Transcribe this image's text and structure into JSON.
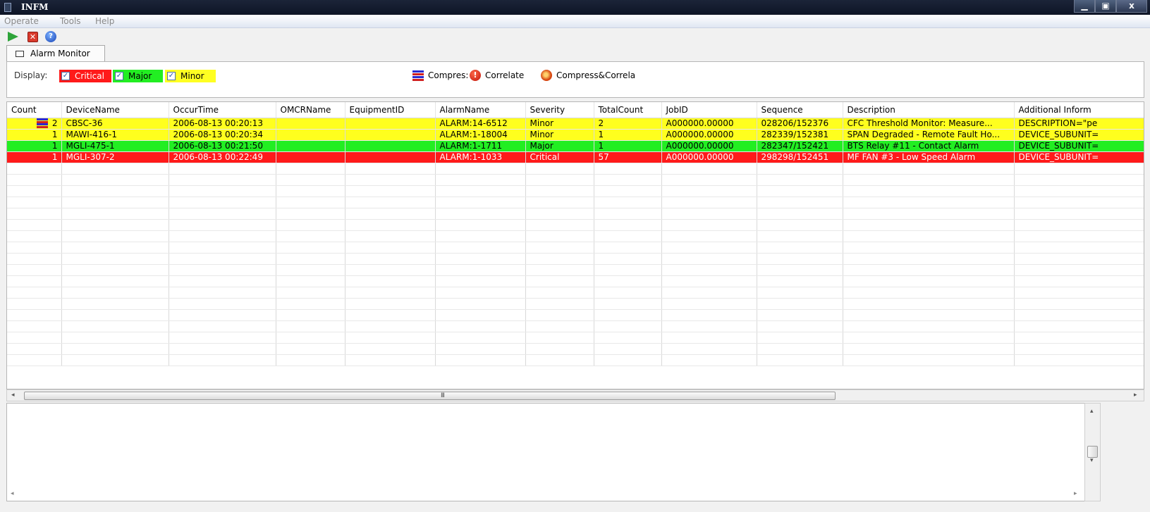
{
  "window": {
    "title": "INFM",
    "buttons": {
      "minimize": "▁",
      "restore": "▣",
      "close": "x"
    }
  },
  "menubar": {
    "items": [
      "Operate",
      "Tools",
      "Help"
    ]
  },
  "toolbar": {
    "stop_glyph": "✕",
    "help_glyph": "?"
  },
  "tabs": [
    {
      "label": "Alarm Monitor"
    }
  ],
  "filters": {
    "display_label": "Display:",
    "critical": {
      "label": "Critical",
      "checked": true,
      "color": "#ff1a1a"
    },
    "major": {
      "label": "Major",
      "checked": true,
      "color": "#22ee22"
    },
    "minor": {
      "label": "Minor",
      "checked": true,
      "color": "#ffff22"
    },
    "check_glyph": "✓"
  },
  "legend": {
    "compress": "Compres:",
    "correlate": "Correlate",
    "correlate_glyph": "!",
    "compress_correlate": "Compress&Correla"
  },
  "table": {
    "columns": [
      "Count",
      "DeviceName",
      "OccurTime",
      "OMCRName",
      "EquipmentID",
      "AlarmName",
      "Severity",
      "TotalCount",
      "JobID",
      "Sequence",
      "Description",
      "Additional Inform"
    ],
    "rows": [
      {
        "severity": "minor",
        "compressed": true,
        "cells": [
          "2",
          "CBSC-36",
          "2006-08-13 00:20:13",
          "",
          "",
          "ALARM:14-6512",
          "Minor",
          "2",
          "A000000.00000",
          "028206/152376",
          "CFC Threshold Monitor: Measure...",
          "DESCRIPTION=\"pe"
        ]
      },
      {
        "severity": "minor",
        "compressed": false,
        "cells": [
          "1",
          "MAWI-416-1",
          "2006-08-13 00:20:34",
          "",
          "",
          "ALARM:1-18004",
          "Minor",
          "1",
          "A000000.00000",
          "282339/152381",
          "SPAN Degraded - Remote Fault Ho...",
          "DEVICE_SUBUNIT="
        ]
      },
      {
        "severity": "major",
        "compressed": false,
        "cells": [
          "1",
          "MGLI-475-1",
          "2006-08-13 00:21:50",
          "",
          "",
          "ALARM:1-1711",
          "Major",
          "1",
          "A000000.00000",
          "282347/152421",
          "BTS Relay #11 - Contact Alarm",
          "DEVICE_SUBUNIT="
        ]
      },
      {
        "severity": "critical",
        "compressed": false,
        "cells": [
          "1",
          "MGLI-307-2",
          "2006-08-13 00:22:49",
          "",
          "",
          "ALARM:1-1033",
          "Critical",
          "57",
          "A000000.00000",
          "298298/152451",
          "MF FAN #3 - Low Speed Alarm",
          "DEVICE_SUBUNIT="
        ]
      }
    ]
  },
  "scroll": {
    "left_arrow": "◂",
    "right_arrow": "▸",
    "up_arrow": "▴",
    "down_arrow": "▾",
    "grip": "III"
  }
}
